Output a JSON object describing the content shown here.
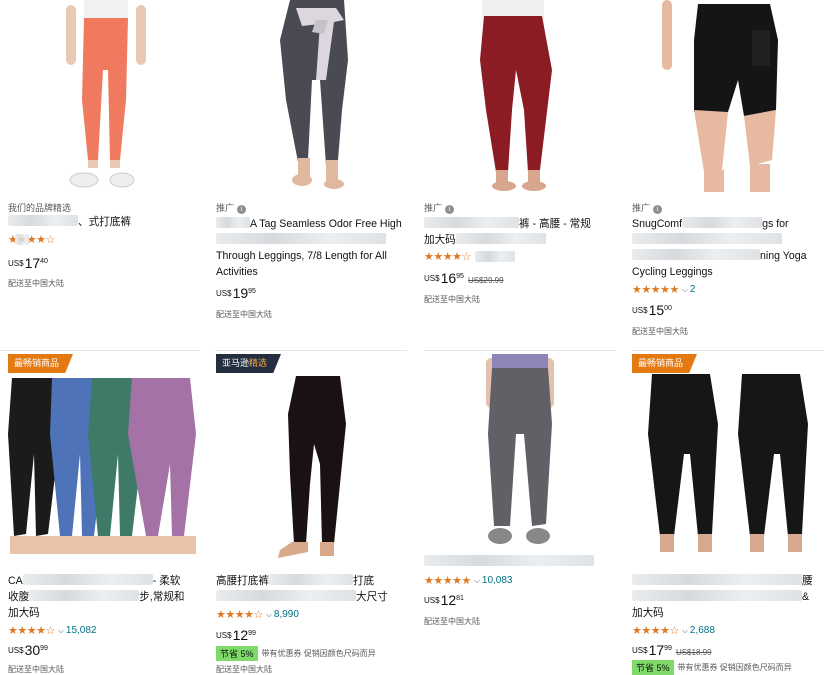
{
  "products": [
    {
      "id": "p1",
      "label": "我们的品牌精选",
      "title_visible": "",
      "title_tail": "、式打底裤",
      "stars": "★★★★☆",
      "rating_count": "",
      "currency": "US$",
      "price_whole": "17",
      "price_frac": "40",
      "list_price": "",
      "shipping": "配送至中国大陆",
      "colors": {
        "top": "#f4f4f4",
        "garment": "#ef7a5f",
        "shoe": "#eeeeee"
      }
    },
    {
      "id": "p2",
      "label": "推广",
      "title_visible": "A Tag Seamless Odor Free High",
      "title_line2": "Through Leggings, 7/8 Length for All",
      "title_line3": "Activities",
      "currency": "US$",
      "price_whole": "19",
      "price_frac": "95",
      "shipping": "配送至中国大陆",
      "colors": {
        "garment": "#4a4a52",
        "ribbon": "#dcd7de"
      }
    },
    {
      "id": "p3",
      "label": "推广",
      "title_visible": "裤 - 高腰 - 常规",
      "title_line2": "加大码",
      "stars": "★★★★☆",
      "rating_count": "",
      "currency": "US$",
      "price_whole": "16",
      "price_frac": "95",
      "list_price": "US$29.99",
      "shipping": "配送至中国大陆",
      "colors": {
        "top": "#f0f0f0",
        "garment": "#8b1c24"
      }
    },
    {
      "id": "p4",
      "label": "推广",
      "title_visible": "SnugComf",
      "title_tail": "gs for",
      "title_line2": "",
      "title_line3": "ning Yoga",
      "title_line4": "Cycling Leggings",
      "stars": "★★★★★",
      "rating_count": "2",
      "currency": "US$",
      "price_whole": "15",
      "price_frac": "00",
      "shipping": "配送至中国大陆",
      "colors": {
        "garment": "#151515"
      }
    },
    {
      "id": "p5",
      "badge": "最畅销商品",
      "title_visible": "CA",
      "title_tail": "- 柔软",
      "title_line2": "收腹",
      "title_line2_tail": "步,常规和",
      "title_line3": "加大码",
      "stars": "★★★★☆",
      "rating_count": "15,082",
      "currency": "US$",
      "price_whole": "30",
      "price_frac": "99",
      "shipping": "配送至中国大陆",
      "colors": {
        "legs": [
          "#1b1b1b",
          "#4f73b8",
          "#3f7a68",
          "#a472a6"
        ]
      }
    },
    {
      "id": "p6",
      "badge_prefix": "亚马逊",
      "badge_accent": "精选",
      "title_visible": "高腰打底裤",
      "title_tail": "打底",
      "title_line2_tail": "大尺寸",
      "stars": "★★★★☆",
      "rating_count": "8,990",
      "currency": "US$",
      "price_whole": "12",
      "price_frac": "99",
      "save_tag": "节省 5%",
      "save_text": "带有优惠券 促销因颜色尺码而异",
      "shipping": "配送至中国大陆",
      "colors": {
        "garment": "#1a1212"
      }
    },
    {
      "id": "p7",
      "stars": "★★★★★",
      "rating_count": "10,083",
      "currency": "US$",
      "price_whole": "12",
      "price_frac": "81",
      "shipping": "配送至中国大陆",
      "colors": {
        "top": "#8d85b8",
        "garment": "#606066",
        "shoe": "#888888"
      }
    },
    {
      "id": "p8",
      "badge": "最畅销商品",
      "title_tail": "腰",
      "title_line2_tail": "&",
      "title_line3": "加大码",
      "stars": "★★★★☆",
      "rating_count": "2,688",
      "currency": "US$",
      "price_whole": "17",
      "price_frac": "99",
      "list_price": "US$18.99",
      "save_tag": "节省 5%",
      "save_text": "带有优惠券 促销因颜色尺码而异",
      "shipping": "配送至中国大陆",
      "colors": {
        "garment": "#161616"
      }
    }
  ]
}
